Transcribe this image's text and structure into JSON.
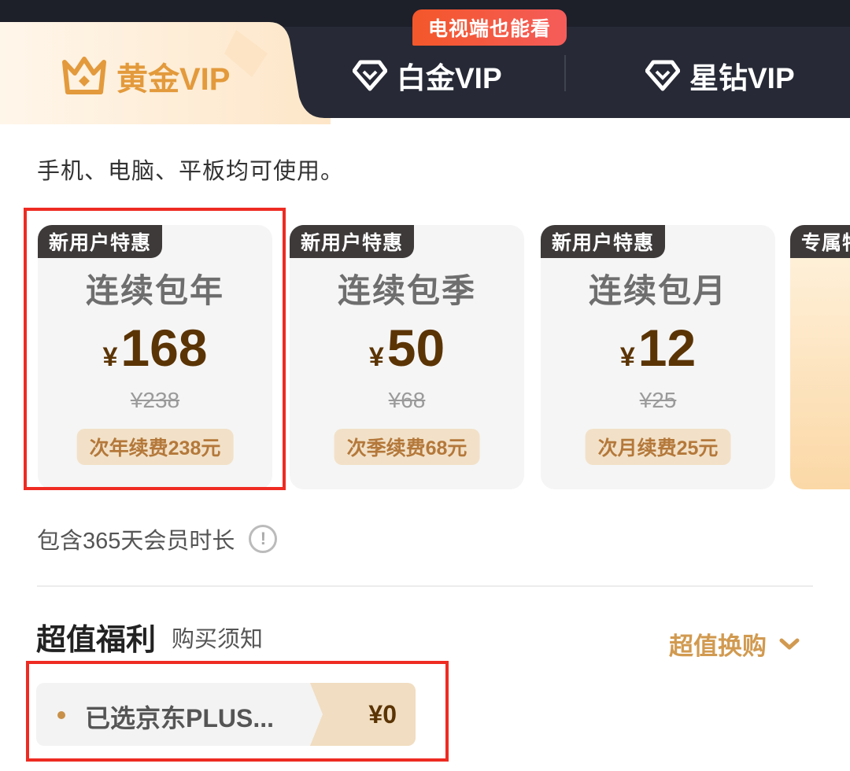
{
  "tabs": {
    "gold": "黄金VIP",
    "platinum": "白金VIP",
    "star": "星钻VIP",
    "tv_badge": "电视端也能看"
  },
  "subtitle": "手机、电脑、平板均可使用。",
  "plans": [
    {
      "tag": "新用户特惠",
      "name": "连续包年",
      "currency": "¥",
      "price": "168",
      "original": "¥238",
      "renew": "次年续费238元"
    },
    {
      "tag": "新用户特惠",
      "name": "连续包季",
      "currency": "¥",
      "price": "50",
      "original": "¥68",
      "renew": "次季续费68元"
    },
    {
      "tag": "新用户特惠",
      "name": "连续包月",
      "currency": "¥",
      "price": "12",
      "original": "¥25",
      "renew": "次月续费25元"
    },
    {
      "tag": "专属特"
    }
  ],
  "duration_note": "包含365天会员时长",
  "benefits": {
    "title": "超值福利",
    "notice": "购买须知",
    "exchange": "超值换购",
    "selected_item": "已选京东PLUS...",
    "selected_price": "¥0"
  },
  "colors": {
    "accent_gold": "#e39a3c",
    "price_brown": "#5b3405",
    "highlight_red": "#ee2b22",
    "header_dark": "#272a36"
  },
  "icons": {
    "gold_tab": "crown-icon",
    "platinum_tab": "diamond-icon",
    "star_tab": "diamond-icon",
    "info": "info-icon",
    "expand": "chevron-down-icon"
  }
}
